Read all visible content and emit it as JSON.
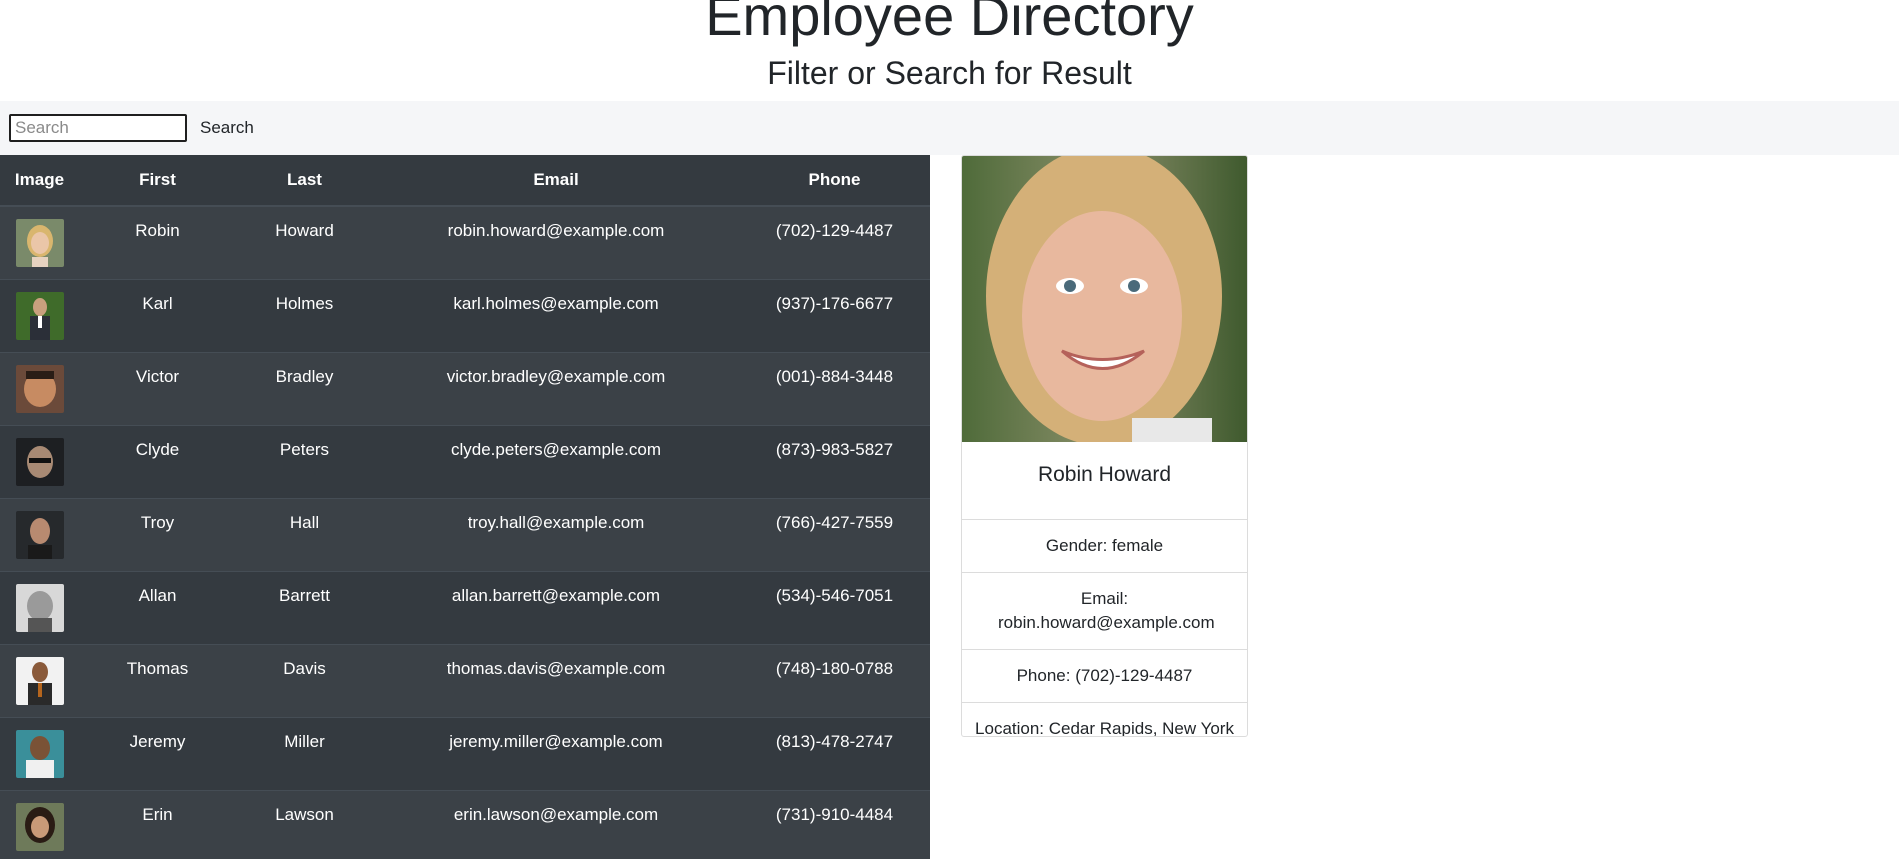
{
  "header": {
    "title": "Employee Directory",
    "subtitle": "Filter or Search for Result"
  },
  "search": {
    "placeholder": "Search",
    "value": "",
    "button_label": "Search"
  },
  "table": {
    "columns": [
      "Image",
      "First",
      "Last",
      "Email",
      "Phone"
    ],
    "rows": [
      {
        "first": "Robin",
        "last": "Howard",
        "email": "robin.howard@example.com",
        "phone": "(702)-129-4487",
        "avatar": "portrait-woman-blonde"
      },
      {
        "first": "Karl",
        "last": "Holmes",
        "email": "karl.holmes@example.com",
        "phone": "(937)-176-6677",
        "avatar": "portrait-man-suit-greenery"
      },
      {
        "first": "Victor",
        "last": "Bradley",
        "email": "victor.bradley@example.com",
        "phone": "(001)-884-3448",
        "avatar": "portrait-man-smiling"
      },
      {
        "first": "Clyde",
        "last": "Peters",
        "email": "clyde.peters@example.com",
        "phone": "(873)-983-5827",
        "avatar": "portrait-man-glasses"
      },
      {
        "first": "Troy",
        "last": "Hall",
        "email": "troy.hall@example.com",
        "phone": "(766)-427-7559",
        "avatar": "portrait-man-dark"
      },
      {
        "first": "Allan",
        "last": "Barrett",
        "email": "allan.barrett@example.com",
        "phone": "(534)-546-7051",
        "avatar": "portrait-man-bw"
      },
      {
        "first": "Thomas",
        "last": "Davis",
        "email": "thomas.davis@example.com",
        "phone": "(748)-180-0788",
        "avatar": "portrait-man-tie"
      },
      {
        "first": "Jeremy",
        "last": "Miller",
        "email": "jeremy.miller@example.com",
        "phone": "(813)-478-2747",
        "avatar": "portrait-man-bald"
      },
      {
        "first": "Erin",
        "last": "Lawson",
        "email": "erin.lawson@example.com",
        "phone": "(731)-910-4484",
        "avatar": "portrait-woman-dark-hair"
      }
    ]
  },
  "card": {
    "name": "Robin Howard",
    "gender": "Gender: female",
    "email": "Email: robin.howard@example.com",
    "phone": "Phone: (702)-129-4487",
    "location": "Location: Cedar Rapids, New York",
    "photo": "portrait-woman-blonde"
  },
  "colors": {
    "table_bg": "#343a40",
    "table_row_alt": "#3b4147",
    "searchbar_bg": "#f5f6f8",
    "text": "#212529"
  }
}
